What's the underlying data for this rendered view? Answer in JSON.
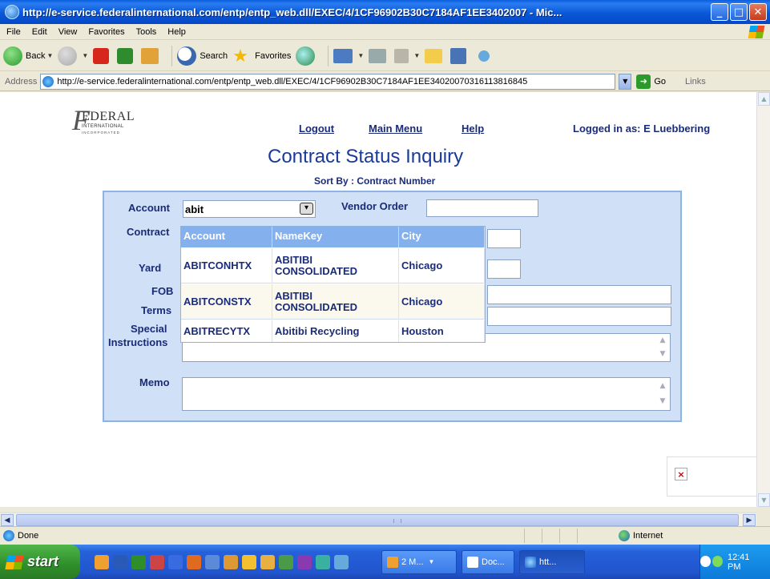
{
  "window": {
    "title": "http://e-service.federalinternational.com/entp/entp_web.dll/EXEC/4/1CF96902B30C7184AF1EE3402007 - Mic...",
    "min": "_",
    "max": "□",
    "close": "✕"
  },
  "menu": {
    "items": [
      "File",
      "Edit",
      "View",
      "Favorites",
      "Tools",
      "Help"
    ]
  },
  "toolbar": {
    "back": "Back",
    "search": "Search",
    "favorites": "Favorites"
  },
  "address": {
    "label": "Address",
    "url": "http://e-service.federalinternational.com/entp/entp_web.dll/EXEC/4/1CF96902B30C7184AF1EE34020070316113816845",
    "go": "Go",
    "links": "Links"
  },
  "logo": {
    "name": "EDERAL",
    "sub1": "INTERNATIONAL",
    "sub2": "INCORPORATED"
  },
  "nav": {
    "logout": "Logout",
    "main_menu": "Main Menu",
    "help": "Help"
  },
  "user": {
    "logged_in": "Logged in as: E Luebbering"
  },
  "page": {
    "title": "Contract Status Inquiry",
    "sort_by": "Sort By : Contract Number"
  },
  "form": {
    "account_label": "Account",
    "account_value": "abit",
    "vendor_order_label": "Vendor Order",
    "contract_label": "Contract",
    "yard_label": "Yard",
    "fob_label": "FOB",
    "terms_label": "Terms",
    "special_label_1": "Special",
    "special_label_2": "Instructions",
    "memo_label": "Memo"
  },
  "dropdown": {
    "headers": [
      "Account",
      "NameKey",
      "City"
    ],
    "rows": [
      {
        "account": "ABITCONHTX",
        "name1": "ABITIBI",
        "name2": "CONSOLIDATED",
        "city": "Chicago"
      },
      {
        "account": "ABITCONSTX",
        "name1": "ABITIBI",
        "name2": "CONSOLIDATED",
        "city": "Chicago"
      },
      {
        "account": "ABITRECYTX",
        "name1": "Abitibi Recycling",
        "name2": "",
        "city": "Houston"
      }
    ]
  },
  "status": {
    "text": "Done",
    "zone": "Internet"
  },
  "taskbar": {
    "start": "start",
    "tasks": [
      "2 M...",
      "Doc...",
      "htt..."
    ],
    "clock": "12:41 PM"
  },
  "colors": {
    "panel_bg": "#cfe0f7",
    "link_blue": "#1a2b78",
    "title_blue": "#1a3a9a",
    "dropdown_header": "#84b0ee"
  }
}
